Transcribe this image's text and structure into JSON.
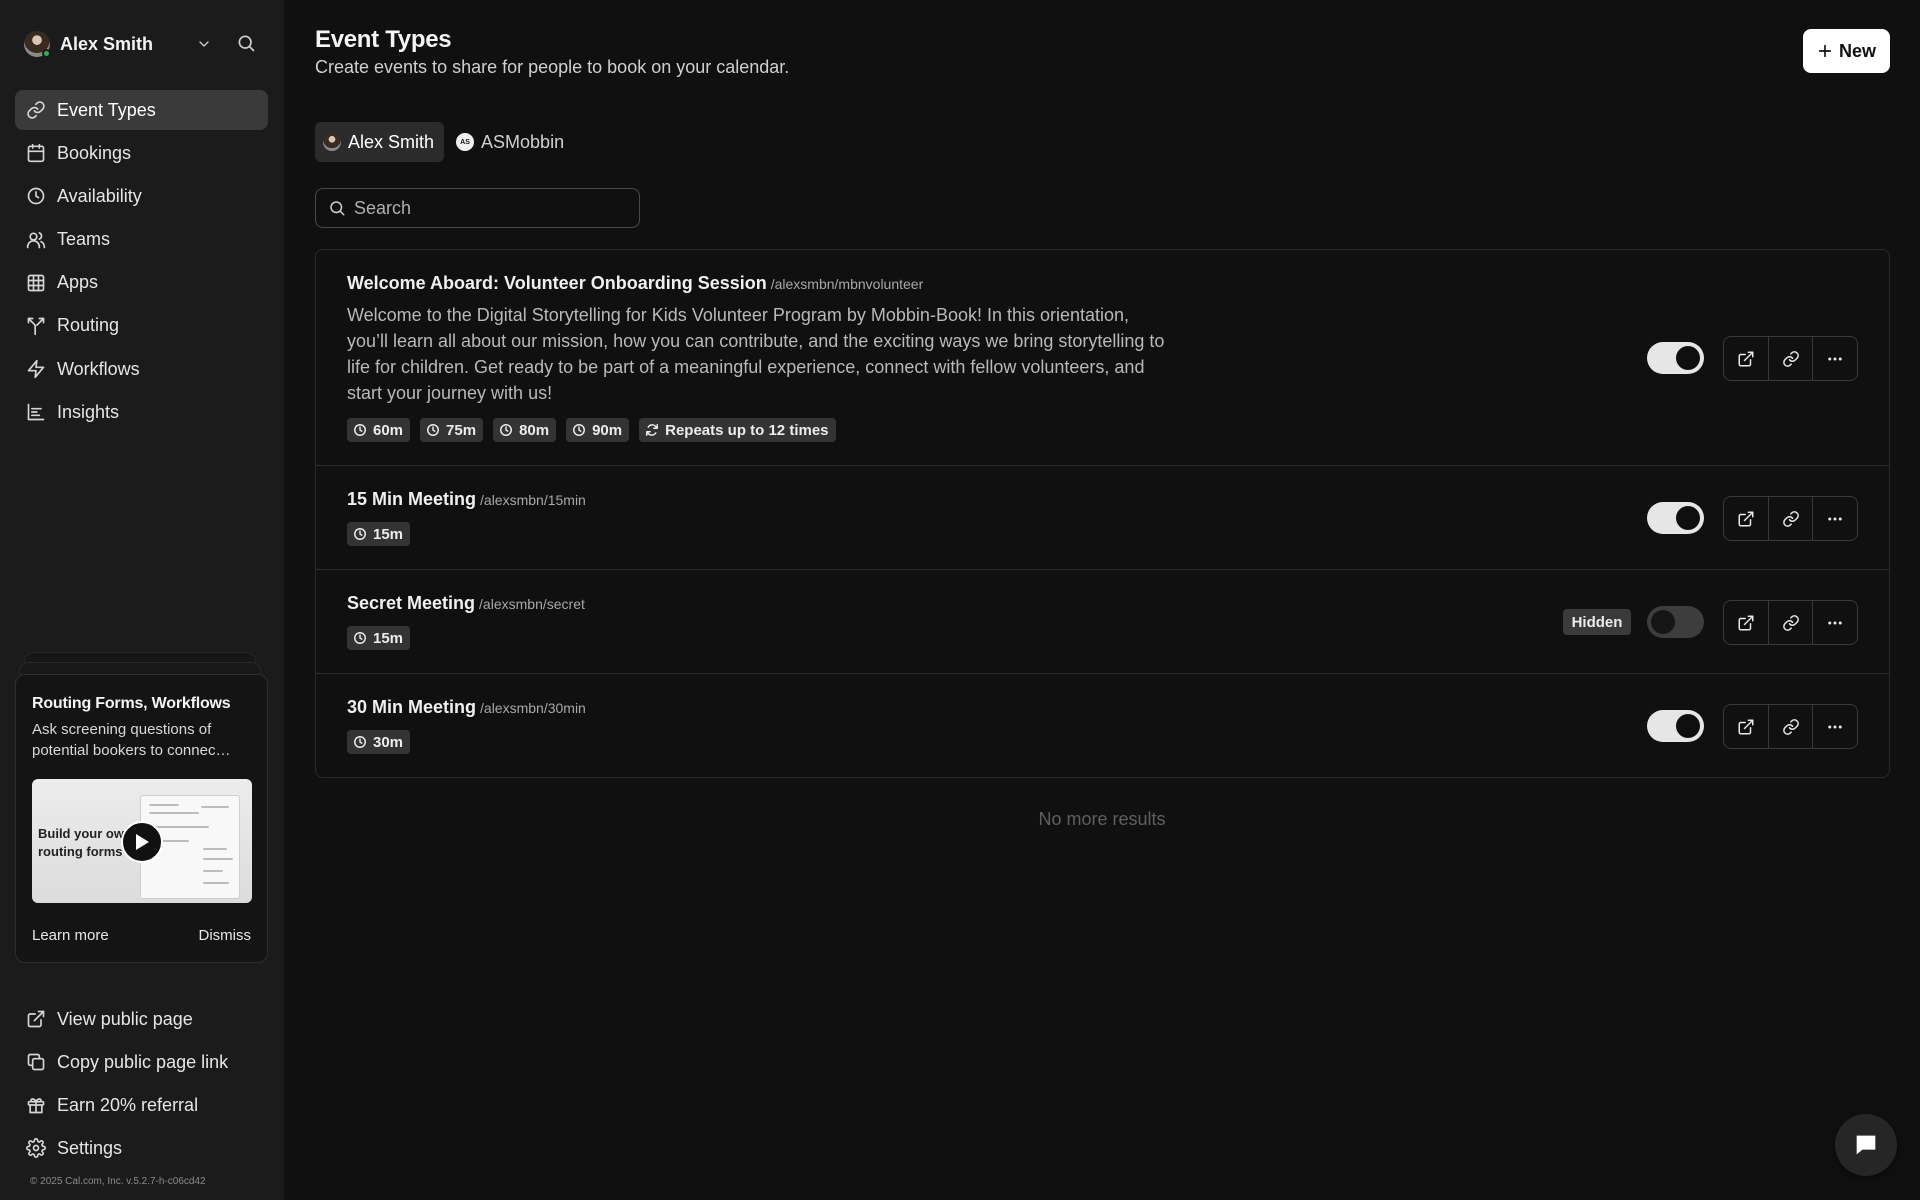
{
  "user": {
    "name": "Alex Smith"
  },
  "nav": {
    "items": [
      {
        "label": "Event Types",
        "icon": "link-icon",
        "active": true
      },
      {
        "label": "Bookings",
        "icon": "calendar-icon"
      },
      {
        "label": "Availability",
        "icon": "clock-icon"
      },
      {
        "label": "Teams",
        "icon": "users-icon"
      },
      {
        "label": "Apps",
        "icon": "grid-icon"
      },
      {
        "label": "Routing",
        "icon": "split-icon"
      },
      {
        "label": "Workflows",
        "icon": "zap-icon"
      },
      {
        "label": "Insights",
        "icon": "chart-icon"
      }
    ],
    "bottom": [
      {
        "label": "View public page",
        "icon": "external-link-icon"
      },
      {
        "label": "Copy public page link",
        "icon": "copy-icon"
      },
      {
        "label": "Earn 20% referral",
        "icon": "gift-icon"
      },
      {
        "label": "Settings",
        "icon": "gear-icon"
      }
    ]
  },
  "promo": {
    "title": "Routing Forms, Workflows",
    "description": "Ask screening questions of potential bookers to connec…",
    "thumb_text_line1": "Build your ow",
    "thumb_text_line2": "routing forms",
    "learn_more": "Learn more",
    "dismiss": "Dismiss"
  },
  "footer": {
    "copyright": "© 2025 Cal.com, Inc. v.5.2.7-h-c06cd42"
  },
  "header": {
    "title": "Event Types",
    "subtitle": "Create events to share for people to book on your calendar.",
    "new_button": "New"
  },
  "tabs": [
    {
      "label": "Alex Smith",
      "active": true
    },
    {
      "label": "ASMobbin",
      "initials": "AS"
    }
  ],
  "search": {
    "placeholder": "Search",
    "value": ""
  },
  "events": [
    {
      "title": "Welcome Aboard: Volunteer Onboarding Session",
      "slug": "/alexsmbn/mbnvolunteer",
      "description": "Welcome to the Digital Storytelling for Kids Volunteer Program by Mobbin-Book! In this orientation, you’ll learn all about our mission, how you can contribute, and the exciting ways we bring storytelling to life for children. Get ready to be part of a meaningful experience, connect with fellow volunteers, and start your journey with us!",
      "durations": [
        "60m",
        "75m",
        "80m",
        "90m"
      ],
      "repeat": "Repeats up to 12 times",
      "enabled": true
    },
    {
      "title": "15 Min Meeting",
      "slug": "/alexsmbn/15min",
      "durations": [
        "15m"
      ],
      "enabled": true
    },
    {
      "title": "Secret Meeting",
      "slug": "/alexsmbn/secret",
      "durations": [
        "15m"
      ],
      "hidden_label": "Hidden",
      "enabled": false
    },
    {
      "title": "30 Min Meeting",
      "slug": "/alexsmbn/30min",
      "durations": [
        "30m"
      ],
      "enabled": true
    }
  ],
  "list_footer": "No more results",
  "colors": {
    "background": "#101010",
    "sidebar": "#1b1b1b",
    "accent": "#ffffff",
    "online": "#2fb44a"
  }
}
